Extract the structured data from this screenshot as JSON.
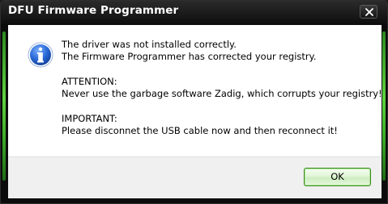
{
  "window": {
    "title": "DFU Firmware Programmer",
    "close_icon": "close-icon"
  },
  "dialog": {
    "icon": "info-icon",
    "message": {
      "line1": "The driver was not installed correctly.",
      "line2": "The Firmware Programmer has corrected your registry.",
      "line3": "ATTENTION:",
      "line4": "Never use the garbage software Zadig, which corrupts your registry!",
      "line5": "IMPORTANT:",
      "line6": "Please disconnet the USB cable now and then reconnect it!"
    },
    "ok_label": "OK"
  },
  "colors": {
    "frame": "#0c0c0c",
    "accent": "#5fd23e",
    "info_blue": "#1f5fc8",
    "ok_border": "#3a8a1e"
  }
}
